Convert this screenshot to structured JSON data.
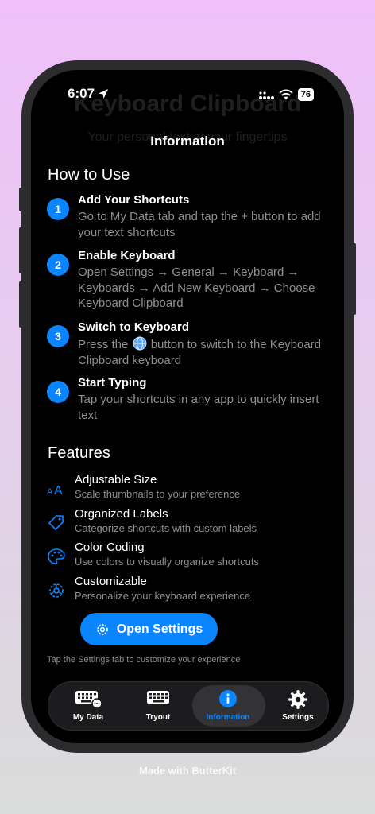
{
  "status": {
    "time": "6:07",
    "battery": "76"
  },
  "background": {
    "title": "Keyboard Clipboard",
    "subtitle": "Your personal text at your fingertips"
  },
  "nav": {
    "title": "Information"
  },
  "how_to": {
    "title": "How to Use",
    "steps": [
      {
        "num": "1",
        "title": "Add Your Shortcuts",
        "desc": "Go to My Data tab and tap the + button to add your text shortcuts"
      },
      {
        "num": "2",
        "title": "Enable Keyboard",
        "desc": "Open Settings → General → Keyboard → Keyboards → Add New Keyboard → Choose Keyboard Clipboard"
      },
      {
        "num": "3",
        "title": "Switch to Keyboard",
        "desc_before": "Press the",
        "desc_after": "button to switch to the Keyboard Clipboard keyboard"
      },
      {
        "num": "4",
        "title": "Start Typing",
        "desc": "Tap your shortcuts in any app to quickly insert text"
      }
    ]
  },
  "features": {
    "title": "Features",
    "items": [
      {
        "icon": "text-size-icon",
        "title": "Adjustable Size",
        "desc": "Scale thumbnails to your preference"
      },
      {
        "icon": "tag-icon",
        "title": "Organized Labels",
        "desc": "Categorize shortcuts with custom labels"
      },
      {
        "icon": "palette-icon",
        "title": "Color Coding",
        "desc": "Use colors to visually organize shortcuts"
      },
      {
        "icon": "gear-badge-icon",
        "title": "Customizable",
        "desc": "Personalize your keyboard experience"
      }
    ]
  },
  "open_settings": {
    "label": "Open Settings",
    "hint": "Tap the Settings tab to customize your experience"
  },
  "tabs": [
    {
      "label": "My Data",
      "icon": "keyboard-badge-icon"
    },
    {
      "label": "Tryout",
      "icon": "keyboard-icon"
    },
    {
      "label": "Information",
      "icon": "info-circle-icon",
      "active": true
    },
    {
      "label": "Settings",
      "icon": "gear-icon"
    }
  ],
  "footer": {
    "text": "Made with ButterKit"
  },
  "colors": {
    "accent": "#0a84ff",
    "secondary_text": "#8e8e93",
    "background": "#000000"
  }
}
